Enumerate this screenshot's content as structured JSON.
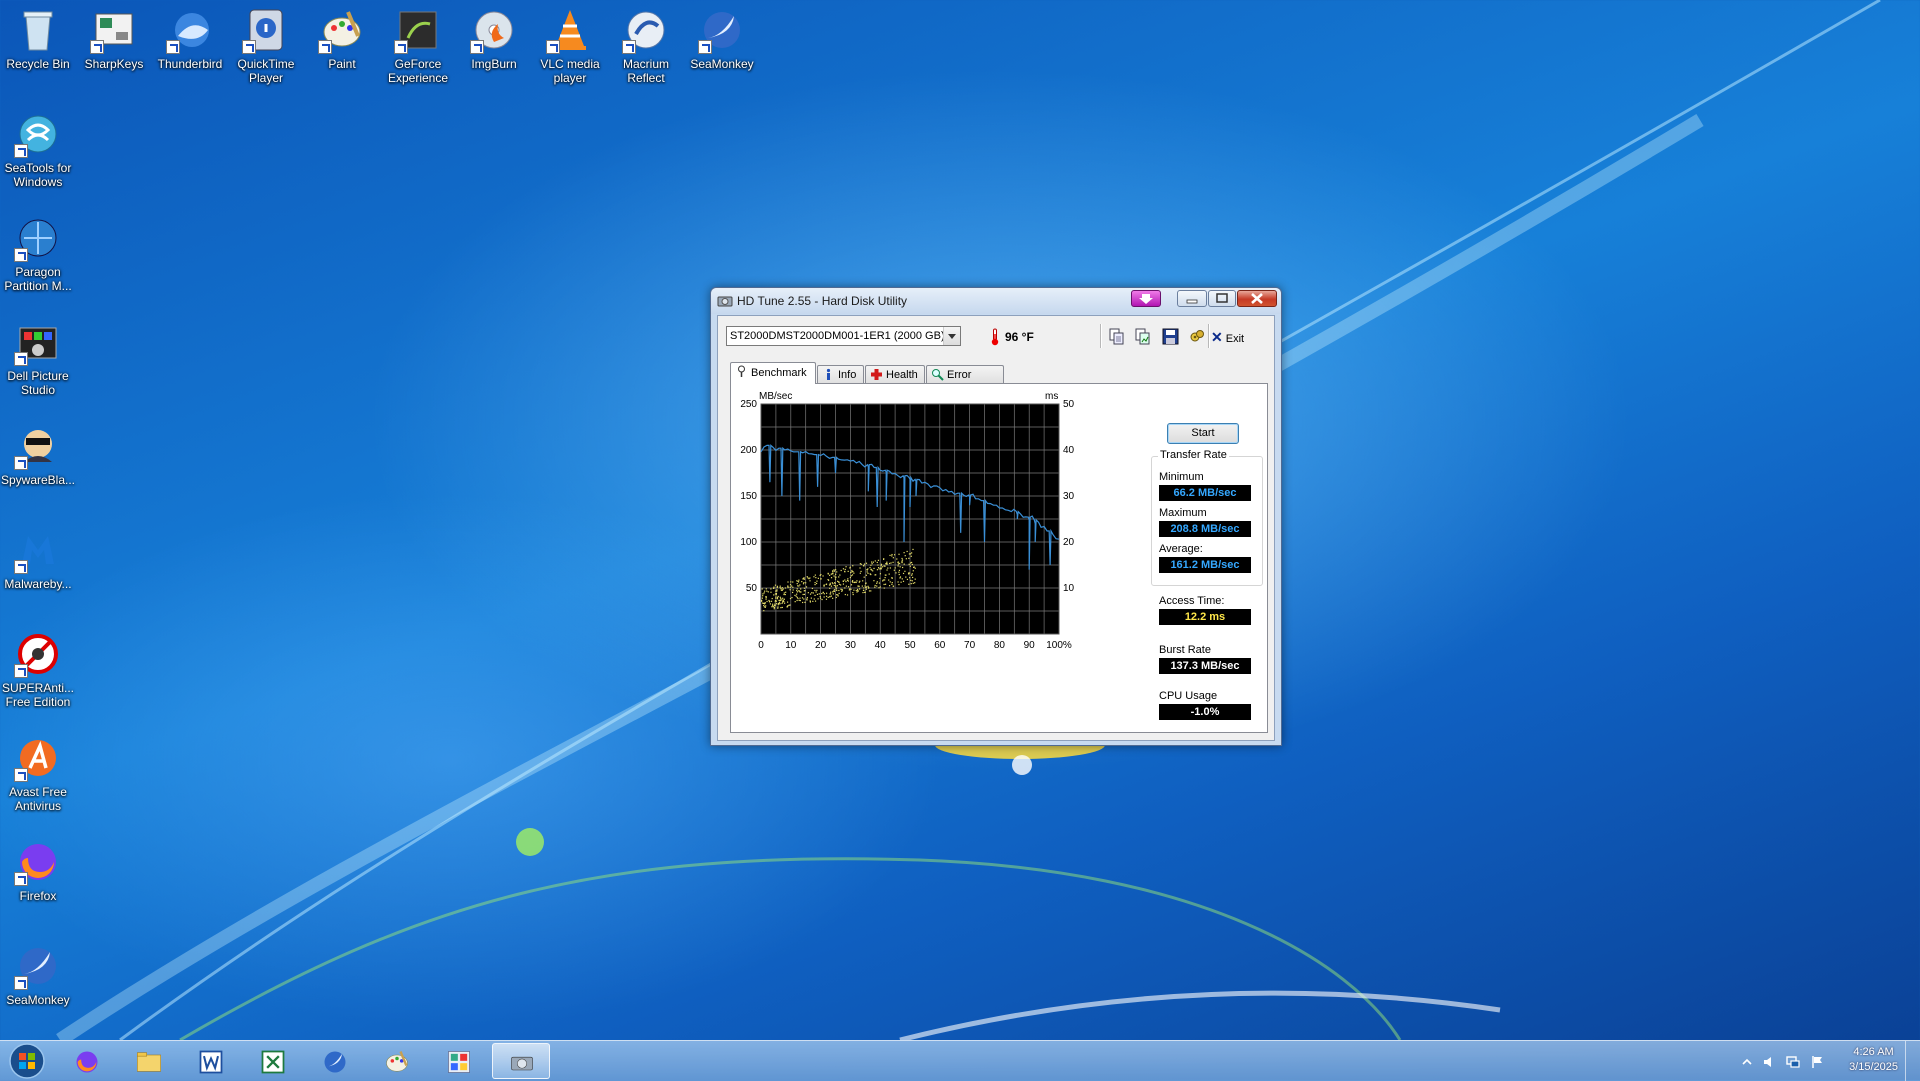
{
  "desktop": {
    "icons": [
      {
        "label": "Recycle Bin",
        "icon": "recycle-bin-icon"
      },
      {
        "label": "SharpKeys",
        "icon": "sharpkeys-icon"
      },
      {
        "label": "Thunderbird",
        "icon": "thunderbird-icon"
      },
      {
        "label": "QuickTime Player",
        "icon": "quicktime-icon"
      },
      {
        "label": "Paint",
        "icon": "paint-icon"
      },
      {
        "label": "GeForce Experience",
        "icon": "geforce-icon"
      },
      {
        "label": "ImgBurn",
        "icon": "imgburn-icon"
      },
      {
        "label": "VLC media player",
        "icon": "vlc-icon"
      },
      {
        "label": "Macrium Reflect",
        "icon": "macrium-icon"
      },
      {
        "label": "SeaMonkey",
        "icon": "seamonkey-icon"
      },
      {
        "label": "SeaTools for Windows",
        "icon": "seatools-icon"
      },
      {
        "label": "Paragon Partition M...",
        "icon": "paragon-icon"
      },
      {
        "label": "Dell Picture Studio",
        "icon": "dell-picture-studio-icon"
      },
      {
        "label": "SpywareBla...",
        "icon": "spywareblaster-icon"
      },
      {
        "label": "Malwareby...",
        "icon": "malwarebytes-icon"
      },
      {
        "label": "SUPERAnti... Free Edition",
        "icon": "superantispyware-icon"
      },
      {
        "label": "Avast Free Antivirus",
        "icon": "avast-icon"
      },
      {
        "label": "Firefox",
        "icon": "firefox-icon"
      },
      {
        "label": "SeaMonkey",
        "icon": "seamonkey-icon"
      }
    ]
  },
  "window": {
    "title": "HD Tune 2.55 - Hard Disk Utility",
    "drive": "ST2000DMST2000DM001-1ER1 (2000 GB)",
    "temperature": "96 °F",
    "exit_label": "Exit",
    "tabs": [
      {
        "label": "Benchmark",
        "icon": "benchmark-icon"
      },
      {
        "label": "Info",
        "icon": "info-icon"
      },
      {
        "label": "Health",
        "icon": "health-icon"
      },
      {
        "label": "Error Scan",
        "icon": "magnifier-icon"
      }
    ],
    "start_label": "Start",
    "transfer_rate": {
      "group_label": "Transfer Rate",
      "minimum_label": "Minimum",
      "minimum_value": "66.2 MB/sec",
      "maximum_label": "Maximum",
      "maximum_value": "208.8 MB/sec",
      "average_label": "Average:",
      "average_value": "161.2 MB/sec"
    },
    "access_time_label": "Access Time:",
    "access_time_value": "12.2 ms",
    "burst_rate_label": "Burst Rate",
    "burst_rate_value": "137.3 MB/sec",
    "cpu_usage_label": "CPU Usage",
    "cpu_usage_value": "-1.0%"
  },
  "chart_data": {
    "type": "line",
    "ylabel_left": "MB/sec",
    "ylabel_right": "ms",
    "y_left_ticks": [
      "250",
      "200",
      "150",
      "100",
      "50"
    ],
    "y_right_ticks": [
      "50",
      "40",
      "30",
      "20",
      "10"
    ],
    "x_ticks": [
      "0",
      "10",
      "20",
      "30",
      "40",
      "50",
      "60",
      "70",
      "80",
      "90",
      "100%"
    ],
    "xlim": [
      0,
      100
    ],
    "ylim_left": [
      0,
      250
    ],
    "ylim_right": [
      0,
      50
    ],
    "grid": true,
    "series": [
      {
        "color": "#3a8fd6",
        "x": [
          0,
          2,
          4,
          6,
          8,
          10,
          12,
          14,
          16,
          18,
          20,
          22,
          24,
          26,
          28,
          30,
          32,
          34,
          36,
          38,
          40,
          42,
          44,
          46,
          48,
          50,
          52,
          54,
          56,
          58,
          60,
          62,
          64,
          66,
          68,
          70,
          72,
          74,
          76,
          78,
          80,
          82,
          84,
          86,
          88,
          90,
          92,
          94,
          96,
          98,
          100
        ],
        "y": [
          198,
          205,
          203,
          202,
          200,
          199,
          198,
          197,
          196,
          195,
          194,
          193,
          192,
          190,
          189,
          188,
          186,
          184,
          182,
          181,
          178,
          176,
          174,
          172,
          170,
          168,
          166,
          164,
          163,
          161,
          159,
          157,
          155,
          153,
          151,
          149,
          147,
          145,
          142,
          140,
          137,
          135,
          133,
          130,
          127,
          124,
          120,
          116,
          112,
          108,
          103
        ],
        "dips": [
          [
            3,
            165
          ],
          [
            7,
            150
          ],
          [
            13,
            145
          ],
          [
            19,
            160
          ],
          [
            25,
            175
          ],
          [
            36,
            155
          ],
          [
            39,
            138
          ],
          [
            42,
            145
          ],
          [
            48,
            100
          ],
          [
            50,
            138
          ],
          [
            52,
            150
          ],
          [
            67,
            110
          ],
          [
            70,
            140
          ],
          [
            75,
            100
          ],
          [
            86,
            125
          ],
          [
            90,
            70
          ],
          [
            92,
            100
          ],
          [
            97,
            75
          ]
        ]
      },
      {
        "color": "#e6de6a",
        "kind": "scatter",
        "description_none": true,
        "x_range": [
          0,
          52
        ],
        "y_range_ms": [
          5,
          19
        ]
      }
    ]
  },
  "taskbar": {
    "items": [
      {
        "icon": "firefox-icon"
      },
      {
        "icon": "file-explorer-icon"
      },
      {
        "icon": "word-icon"
      },
      {
        "icon": "excel-icon"
      },
      {
        "icon": "seamonkey-icon"
      },
      {
        "icon": "paint-icon"
      },
      {
        "icon": "control-panel-icon"
      },
      {
        "icon": "hdtune-icon"
      }
    ],
    "time": "4:26 AM",
    "date": "3/15/2025"
  }
}
